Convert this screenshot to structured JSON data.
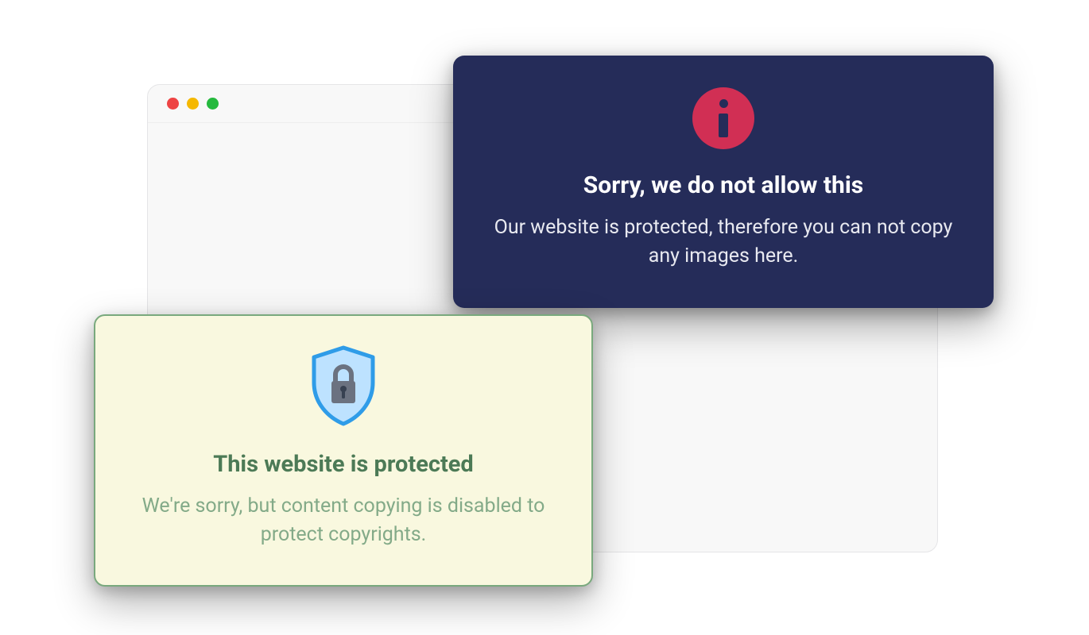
{
  "popups": {
    "dark": {
      "title": "Sorry, we do not allow this",
      "body": "Our website is protected, therefore you can not copy any images here.",
      "icon": "info-icon"
    },
    "light": {
      "title": "This website is protected",
      "body": "We're sorry, but content copying is disabled to protect copyrights.",
      "icon": "shield-lock-icon"
    }
  },
  "colors": {
    "dark_bg": "#252c59",
    "info_icon_bg": "#d12f54",
    "light_bg": "#f9f8df",
    "light_border": "#79a97d",
    "light_title": "#4c7a56",
    "light_body": "#83aa88"
  }
}
